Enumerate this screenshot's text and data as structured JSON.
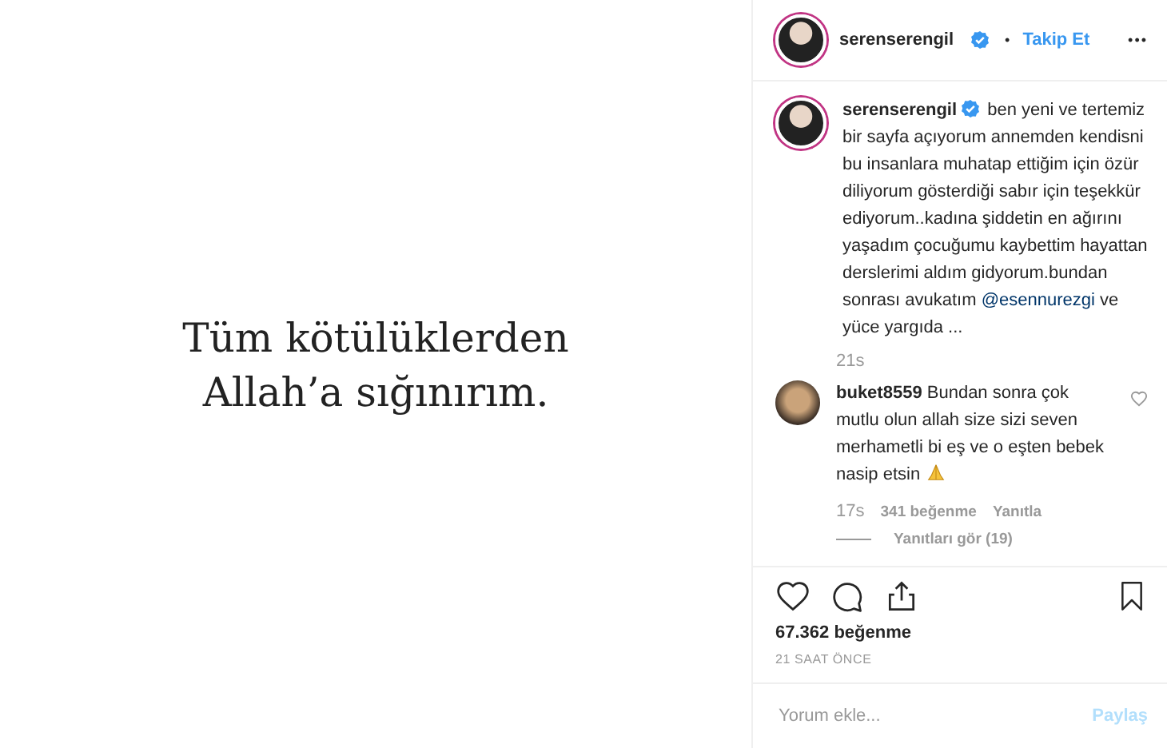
{
  "post_image": {
    "lines": [
      "Tüm kötülüklerden",
      "Allah’a sığınırım."
    ]
  },
  "header": {
    "username": "serenserengil",
    "verified": true,
    "separator": "•",
    "follow": "Takip Et",
    "more": "•••"
  },
  "caption": {
    "username": "serenserengil",
    "verified": true,
    "text": "ben yeni ve tertemiz bir sayfa açıyorum annemden kendisni bu insanlara muhatap ettiğim için özür diliyorum gösterdiği sabır için teşekkür ediyorum..kadına şiddetin en ağırını yaşadım çocuğumu kaybettim hayattan derslerimi aldım gidyorum.bundan sonrası avukatım",
    "mention": "@esennurezgi",
    "text_end": "ve yüce yargıda ...",
    "time": "21s"
  },
  "comments": [
    {
      "username": "buket8559",
      "text": "Bundan sonra çok mutlu olun allah size sizi seven merhametli bi eş ve o eşten bebek nasip etsin",
      "emoji": true,
      "liked": false,
      "time": "17s",
      "likes": "341 beğenme",
      "reply": "Yanıtla",
      "view_replies": "Yanıtları gör (19)"
    }
  ],
  "actions": {
    "likes": "67.362 beğenme",
    "time": "21 SAAT ÖNCE",
    "saved": false
  },
  "comment_box": {
    "placeholder": "Yorum ekle...",
    "submit": "Paylaş"
  }
}
